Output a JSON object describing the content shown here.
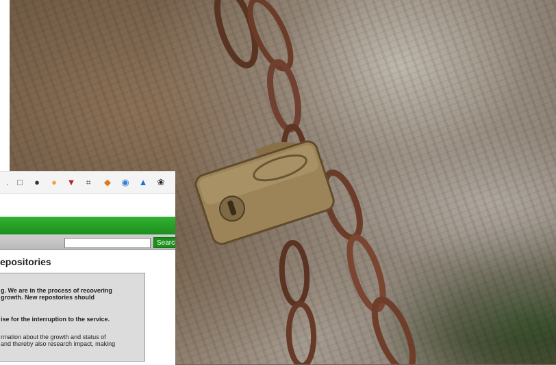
{
  "toolbar": {
    "icons": [
      {
        "name": "reader-icon",
        "glyph": "□",
        "color": "#555555"
      },
      {
        "name": "account-icon",
        "glyph": "●",
        "color": "#333333"
      },
      {
        "name": "extension-orange-icon",
        "glyph": "●",
        "color": "#f2a53a"
      },
      {
        "name": "shield-red-icon",
        "glyph": "▼",
        "color": "#b8222a"
      },
      {
        "name": "grid-icon",
        "glyph": "⌗",
        "color": "#555555"
      },
      {
        "name": "fox-icon",
        "glyph": "◆",
        "color": "#e2761b"
      },
      {
        "name": "globe-blue-icon",
        "glyph": "◉",
        "color": "#2f7fd6"
      },
      {
        "name": "drop-blue-icon",
        "glyph": "▲",
        "color": "#1e6fd9"
      },
      {
        "name": "tool-icon",
        "glyph": "❀",
        "color": "#222222"
      }
    ]
  },
  "header": {
    "accent": "#1f9a1f"
  },
  "search": {
    "placeholder": "",
    "button_label": "Search"
  },
  "page": {
    "heading": "epositories"
  },
  "notice": {
    "line1": "g. We are in the process of recovering",
    "line2": "growth. New repostories should",
    "line3": "ise for the interruption to the service.",
    "line4": "rmation about the growth and status of",
    "line5": "and thereby also research impact, making"
  }
}
